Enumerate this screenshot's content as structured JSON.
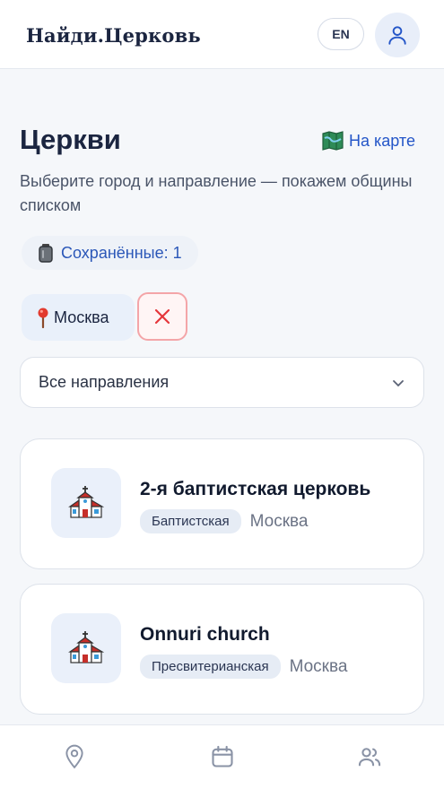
{
  "header": {
    "brand": "Найди.Церковь",
    "lang_label": "EN",
    "profile_icon": "user-icon"
  },
  "main": {
    "title": "Церкви",
    "map_link": {
      "label": "На карте",
      "icon": "map-icon"
    },
    "subtitle": "Выберите город и направление — покажем общины списком",
    "saved_chip": {
      "label": "Сохранённые: 1",
      "icon": "bookmark-jar-icon"
    },
    "city_filter": {
      "label": "Москва",
      "icon": "pin-icon"
    },
    "clear_icon": "close-icon",
    "denomination_select": {
      "value": "Все направления",
      "icon": "chevron-down-icon"
    }
  },
  "churches": [
    {
      "name": "2-я баптистская церковь",
      "denomination": "Баптистская",
      "city": "Москва",
      "icon": "church-icon"
    },
    {
      "name": "Onnuri church",
      "denomination": "Пресвитерианская",
      "city": "Москва",
      "icon": "church-icon"
    }
  ],
  "bottom_nav": [
    {
      "name": "map",
      "icon": "location-pin-icon"
    },
    {
      "name": "calendar",
      "icon": "calendar-icon"
    },
    {
      "name": "community",
      "icon": "users-icon"
    }
  ],
  "colors": {
    "accent": "#2456c8",
    "background": "#f5f7fa",
    "danger": "#e5363b",
    "danger_border": "#f4a5a8",
    "text": "#1b2540"
  }
}
